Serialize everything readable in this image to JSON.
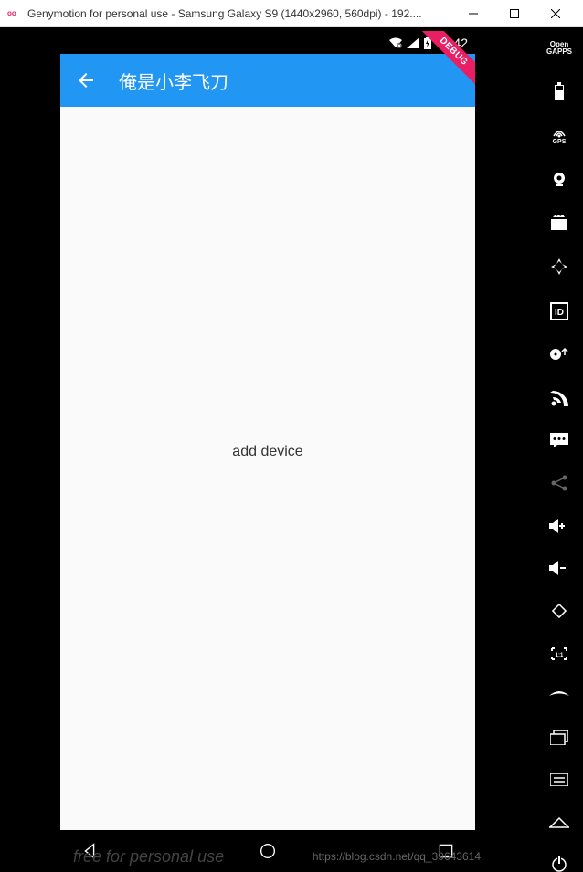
{
  "window": {
    "icon_text": "oo",
    "title": "Genymotion for personal use - Samsung Galaxy S9 (1440x2960, 560dpi) - 192...."
  },
  "status_bar": {
    "time": "12:42"
  },
  "debug_ribbon": "DEBUG",
  "app_bar": {
    "title": "俺是小李飞刀"
  },
  "content": {
    "text": "add device"
  },
  "sidebar": {
    "open_gapps": "Open\nGAPPS",
    "gps_label": "GPS"
  },
  "watermarks": {
    "left": "free for personal use",
    "right": "https://blog.csdn.net/qq_39643614"
  }
}
